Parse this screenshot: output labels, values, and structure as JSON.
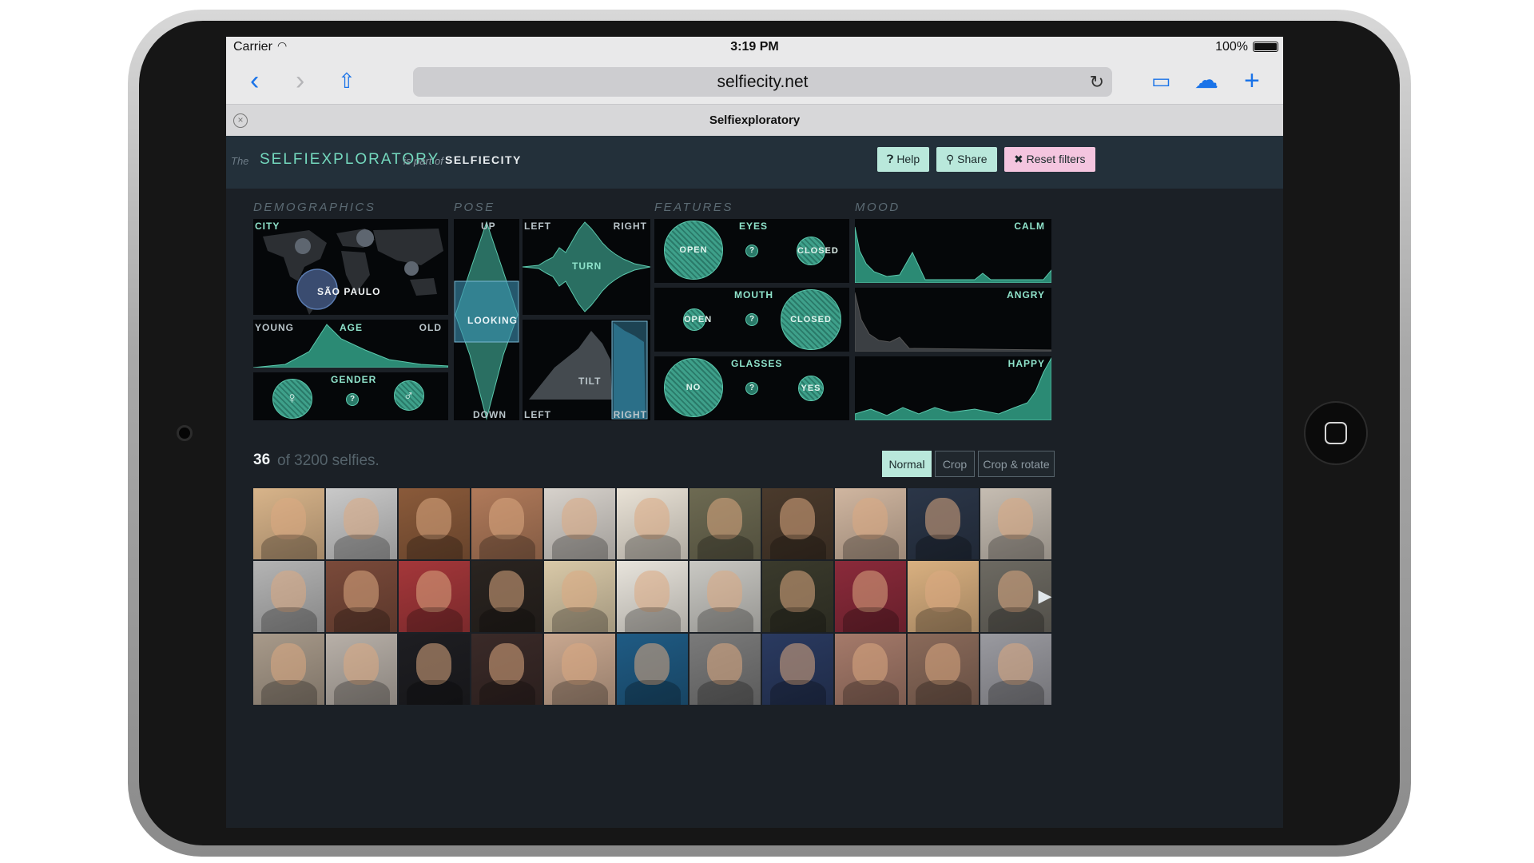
{
  "status": {
    "carrier": "Carrier",
    "time": "3:19 PM",
    "battery": "100%"
  },
  "browser": {
    "url": "selfiecity.net",
    "tab_title": "Selfiexploratory"
  },
  "header": {
    "the": "The",
    "app_name": "SELFIEXPLORATORY",
    "part_of": "is part of",
    "parent": "SELFIECITY",
    "help_label": "Help",
    "share_label": "Share",
    "reset_label": "Reset filters"
  },
  "categories": {
    "demographics": "DEMOGRAPHICS",
    "pose": "POSE",
    "features": "FEATURES",
    "mood": "MOOD"
  },
  "panels": {
    "city": {
      "label": "CITY",
      "selected": "SÃO PAULO"
    },
    "age": {
      "left": "YOUNG",
      "label": "AGE",
      "right": "OLD"
    },
    "gender": {
      "label": "GENDER",
      "female": "♀",
      "unknown": "?",
      "male": "♂"
    },
    "looking": {
      "top": "UP",
      "label": "LOOKING",
      "bottom": "DOWN"
    },
    "turn": {
      "left": "LEFT",
      "label": "TURN",
      "right": "RIGHT"
    },
    "tilt": {
      "label": "TILT",
      "left": "LEFT",
      "right": "RIGHT"
    },
    "eyes": {
      "label": "EYES",
      "a": "OPEN",
      "q": "?",
      "b": "CLOSED"
    },
    "mouth": {
      "label": "MOUTH",
      "a": "OPEN",
      "q": "?",
      "b": "CLOSED"
    },
    "glasses": {
      "label": "GLASSES",
      "a": "NO",
      "q": "?",
      "b": "YES"
    },
    "calm": {
      "label": "CALM"
    },
    "angry": {
      "label": "ANGRY"
    },
    "happy": {
      "label": "HAPPY"
    }
  },
  "results": {
    "count": "36",
    "rest": "of 3200 selfies."
  },
  "view_modes": [
    "Normal",
    "Crop",
    "Crop & rotate"
  ],
  "active_mode": "Normal",
  "thumbnail_colors": [
    "#d8b48a",
    "#c9c9c9",
    "#8a5a3a",
    "#b07a5a",
    "#d7d2cc",
    "#e9e2d6",
    "#6d6a52",
    "#4a3a2c",
    "#d0b6a0",
    "#2b3648",
    "#c6bdb2",
    "#b4b4b4",
    "#7a4a3a",
    "#a4373a",
    "#2a2420",
    "#d9c9a8",
    "#e8e4dc",
    "#c9c8c3",
    "#3a3a2c",
    "#8a2a3a",
    "#d9b080",
    "#6d6a62",
    "#a89a8a",
    "#b8b0a8",
    "#1e1e22",
    "#3a2a28",
    "#c9a890",
    "#1f5b84",
    "#7a7a7a",
    "#2a3a60",
    "#a57a6a",
    "#8a6a5a",
    "#9a9aa0"
  ]
}
